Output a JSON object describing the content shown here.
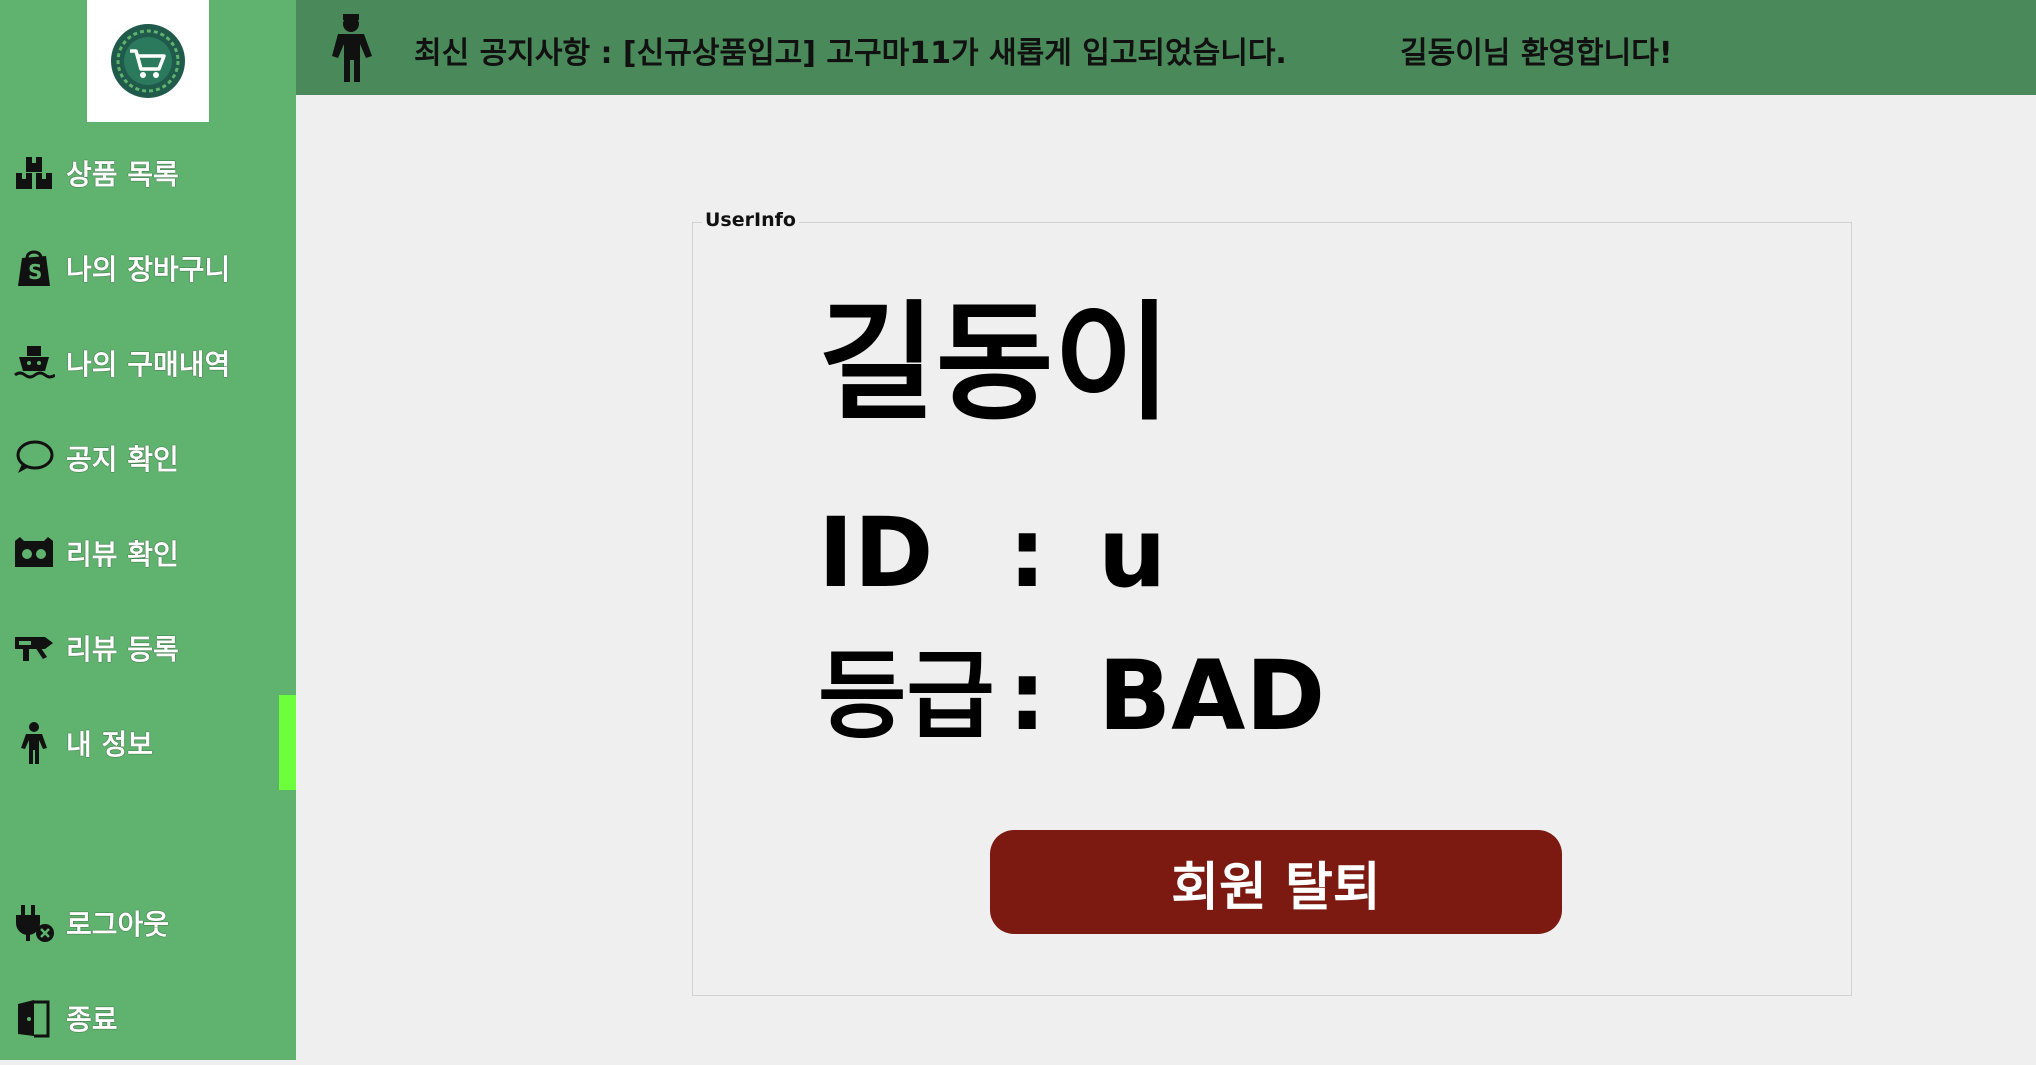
{
  "colors": {
    "sidebar": "#5fb36e",
    "topbar": "#4a8a5a",
    "active_indicator": "#6dff3c",
    "withdraw_button": "#7c1a12",
    "background": "#efefef"
  },
  "sidebar": {
    "logo_icon": "shopping-cart-logo",
    "items": [
      {
        "label": "상품 목록",
        "icon": "boxes-icon"
      },
      {
        "label": "나의 장바구니",
        "icon": "shopping-bag-icon"
      },
      {
        "label": "나의 구매내역",
        "icon": "ship-icon"
      },
      {
        "label": "공지 확인",
        "icon": "chat-bubble-icon"
      },
      {
        "label": "리뷰 확인",
        "icon": "review-icon"
      },
      {
        "label": "리뷰 등록",
        "icon": "review-write-icon"
      },
      {
        "label": "내 정보",
        "icon": "person-icon",
        "active": true
      }
    ],
    "logout_label": "로그아웃",
    "exit_label": "종료"
  },
  "topbar": {
    "notice": "최신 공지사항 : [신규상품입고] 고구마11가 새롭게 입고되었습니다.",
    "welcome": "길동이님 환영합니다!"
  },
  "user_info": {
    "group_title": "UserInfo",
    "name": "길동이",
    "id_label": "ID",
    "colon": ":",
    "id_value": "u",
    "grade_label": "등급",
    "grade_value": "BAD"
  },
  "withdraw_button": "회원 탈퇴"
}
